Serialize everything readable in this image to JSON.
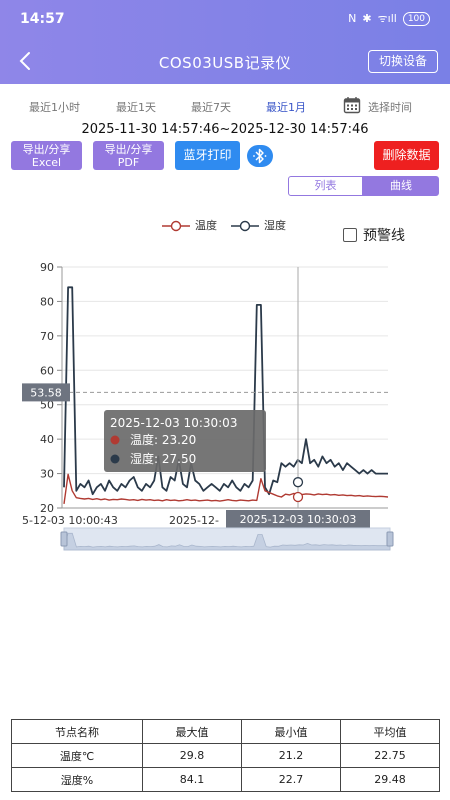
{
  "status_bar": {
    "time": "14:57",
    "nfc": "N",
    "bluetooth": "✱",
    "signal": "ᯤıll",
    "battery": "100"
  },
  "header": {
    "title": "COS03USB记录仪",
    "switch_label": "切换设备"
  },
  "ranges": {
    "items": [
      "最近1小时",
      "最近1天",
      "最近7天",
      "最近1月"
    ],
    "active_index": 3,
    "pick_time_label": "选择时间"
  },
  "date_range": "2025-11-30 14:57:46~2025-12-30 14:57:46",
  "actions": {
    "export_excel_line1": "导出/分享",
    "export_excel_line2": "Excel",
    "export_pdf_line1": "导出/分享",
    "export_pdf_line2": "PDF",
    "bt_print": "蓝牙打印",
    "delete": "删除数据"
  },
  "view_toggle": {
    "list": "列表",
    "curve": "曲线",
    "active": "curve"
  },
  "legend": {
    "temp": "温度",
    "humid": "湿度"
  },
  "warning_line_label": "预警线",
  "colors": {
    "temp": "#b03a32",
    "humid": "#2b3a4a",
    "accent": "#9378e0",
    "blue": "#2f8bf0",
    "red": "#ee2020"
  },
  "chart_data": {
    "type": "line",
    "ylim": [
      20,
      90
    ],
    "yticks": [
      20,
      30,
      40,
      50,
      60,
      70,
      80,
      90
    ],
    "x_labels": [
      "5-12-03 10:00:43",
      "2025-12-"
    ],
    "crosshair_y_label": "53.58",
    "crosshair_x_label": "2025-12-03 10:30:03",
    "tooltip": {
      "title": "2025-12-03 10:30:03",
      "temp_label": "温度: 23.20",
      "humid_label": "湿度: 27.50"
    },
    "series": [
      {
        "name": "温度",
        "values": [
          21.2,
          29.8,
          25,
          23,
          22.8,
          22.6,
          22.8,
          22.5,
          22.7,
          22.4,
          22.6,
          22.3,
          22.5,
          22.4,
          22.6,
          22.5,
          22.3,
          22.4,
          22.2,
          22.5,
          22.3,
          22.4,
          22.2,
          22.3,
          22.1,
          22.4,
          22.2,
          22.3,
          22.1,
          22.2,
          22.4,
          22.2,
          22.3,
          22.1,
          22.2,
          22.3,
          22.1,
          22.2,
          22.0,
          22.2,
          22.4,
          22.2,
          22.1,
          22.3,
          22.2,
          22.1,
          22.3,
          22.2,
          28.5,
          25,
          24.5,
          24,
          23.5,
          23.2,
          24,
          23.8,
          24.2,
          24,
          23.9,
          24.1,
          24,
          23.8,
          24.1,
          23.9,
          24,
          23.8,
          23.9,
          23.7,
          23.8,
          23.6,
          23.7,
          23.5,
          23.6,
          23.4,
          23.5,
          23.4,
          23.3,
          23.4,
          23.3,
          23.2
        ]
      },
      {
        "name": "湿度",
        "values": [
          26,
          84.1,
          84.1,
          25,
          27,
          26,
          28,
          24,
          26,
          27,
          25,
          28,
          26,
          25,
          27,
          26,
          28,
          29,
          26,
          25,
          27,
          26,
          28,
          35,
          26,
          25,
          29,
          28,
          34,
          27,
          26,
          33,
          28,
          27,
          25,
          26,
          27,
          26,
          25,
          27,
          26,
          28,
          26,
          25,
          27,
          26,
          28,
          79,
          79,
          26,
          24,
          28,
          27.5,
          33,
          32,
          33,
          32,
          34,
          33,
          40,
          33,
          34,
          32,
          35,
          33,
          34,
          32,
          33,
          31,
          33,
          32,
          31,
          30,
          31,
          30,
          31,
          30,
          30,
          30,
          30
        ]
      }
    ]
  },
  "stats_table": {
    "headers": [
      "节点名称",
      "最大值",
      "最小值",
      "平均值"
    ],
    "rows": [
      [
        "温度℃",
        "29.8",
        "21.2",
        "22.75"
      ],
      [
        "湿度%",
        "84.1",
        "22.7",
        "29.48"
      ]
    ]
  }
}
